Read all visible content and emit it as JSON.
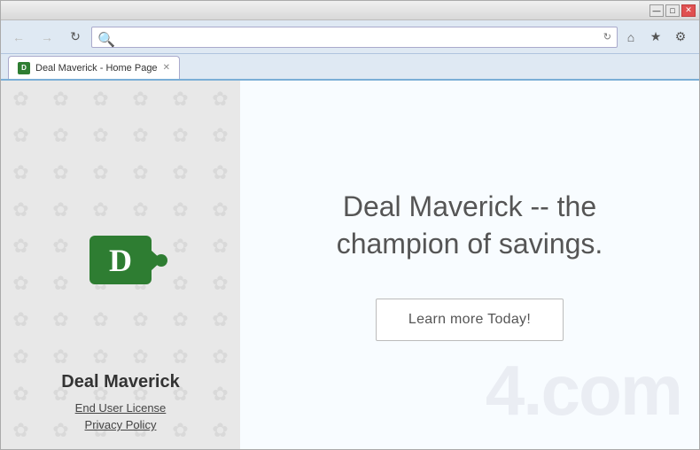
{
  "window": {
    "title": "Deal Maverick - Home Page",
    "title_bar_buttons": {
      "minimize": "—",
      "maximize": "□",
      "close": "✕"
    }
  },
  "browser": {
    "back_label": "←",
    "forward_label": "→",
    "refresh_label": "↻",
    "address_value": "",
    "address_placeholder": "🔍",
    "tab_title": "Deal Maverick - Home Page",
    "tab_favicon_letter": "D",
    "home_icon": "⌂",
    "star_icon": "★",
    "settings_icon": "⚙"
  },
  "sidebar": {
    "logo_letter": "D",
    "title": "Deal Maverick",
    "link_eula": "End User License",
    "link_privacy": "Privacy Policy"
  },
  "main": {
    "heading_line1": "Deal Maverick -- the",
    "heading_line2": "champion of savings.",
    "cta_label": "Learn more Today!",
    "watermark": "4.com"
  },
  "pattern": {
    "symbol": "✿"
  }
}
